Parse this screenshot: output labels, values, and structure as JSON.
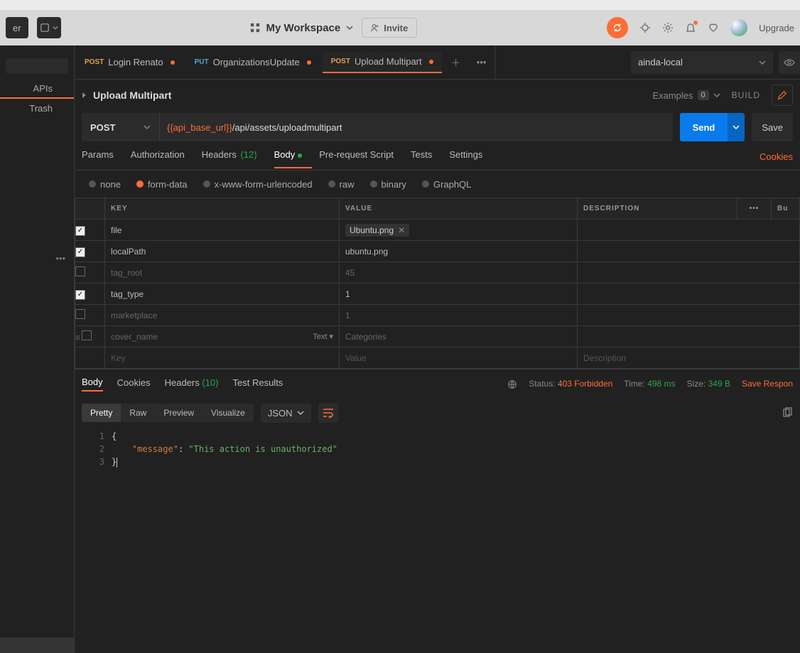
{
  "header": {
    "new_label": "er",
    "workspace": "My Workspace",
    "invite": "Invite",
    "upgrade": "Upgrade"
  },
  "sidebar": {
    "tabs": {
      "apis": "APIs",
      "trash": "Trash"
    }
  },
  "tabs": [
    {
      "method": "POST",
      "method_class": "method-post",
      "label": "Login Renato",
      "dirty": true,
      "active": false
    },
    {
      "method": "PUT",
      "method_class": "method-put",
      "label": "OrganizationsUpdate",
      "dirty": true,
      "active": false
    },
    {
      "method": "POST",
      "method_class": "method-post",
      "label": "Upload Multipart",
      "dirty": true,
      "active": true
    }
  ],
  "environment": {
    "name": "ainda-local"
  },
  "title": {
    "name": "Upload Multipart",
    "examples_label": "Examples",
    "examples_count": "0",
    "build": "BUILD"
  },
  "request": {
    "method": "POST",
    "url_var": "{{api_base_url}}",
    "url_rest": "/api/assets/uploadmultipart",
    "send": "Send",
    "save": "Save"
  },
  "req_subtabs": {
    "params": "Params",
    "auth": "Authorization",
    "headers": "Headers",
    "headers_count": "(12)",
    "body": "Body",
    "prescript": "Pre-request Script",
    "tests": "Tests",
    "settings": "Settings",
    "cookies": "Cookies"
  },
  "body_types": {
    "none": "none",
    "formdata": "form-data",
    "urlenc": "x-www-form-urlencoded",
    "raw": "raw",
    "binary": "binary",
    "graphql": "GraphQL"
  },
  "fd_headers": {
    "key": "KEY",
    "value": "VALUE",
    "desc": "DESCRIPTION",
    "bulk": "Bu"
  },
  "fd_rows": [
    {
      "checked": true,
      "key": "file",
      "value_type": "file",
      "value": "Ubuntu.png",
      "desc": ""
    },
    {
      "checked": true,
      "key": "localPath",
      "value_type": "text",
      "value": "ubuntu.png",
      "desc": ""
    },
    {
      "checked": false,
      "key": "tag_root",
      "value_type": "text",
      "value": "45",
      "desc": ""
    },
    {
      "checked": true,
      "key": "tag_type",
      "value_type": "text",
      "value": "1",
      "desc": ""
    },
    {
      "checked": false,
      "key": "marketplace",
      "value_type": "text",
      "value": "1",
      "desc": ""
    },
    {
      "checked": false,
      "key": "cover_name",
      "value_type": "text",
      "value": "Categories",
      "desc": "",
      "hover": true,
      "type_label": "Text"
    }
  ],
  "fd_placeholder": {
    "key": "Key",
    "value": "Value",
    "desc": "Description"
  },
  "response": {
    "tabs": {
      "body": "Body",
      "cookies": "Cookies",
      "headers": "Headers",
      "headers_count": "(10)",
      "tests": "Test Results"
    },
    "status_label": "Status:",
    "status": "403 Forbidden",
    "time_label": "Time:",
    "time": "498 ms",
    "size_label": "Size:",
    "size": "349 B",
    "save": "Save Respon",
    "views": {
      "pretty": "Pretty",
      "raw": "Raw",
      "preview": "Preview",
      "visualize": "Visualize",
      "format": "JSON"
    },
    "json": {
      "l1": "{",
      "l2_indent": "    ",
      "l2_key": "\"message\"",
      "l2_colon": ": ",
      "l2_val": "\"This action is unauthorized\"",
      "l3": "}"
    },
    "line_numbers": [
      "1",
      "2",
      "3"
    ]
  }
}
